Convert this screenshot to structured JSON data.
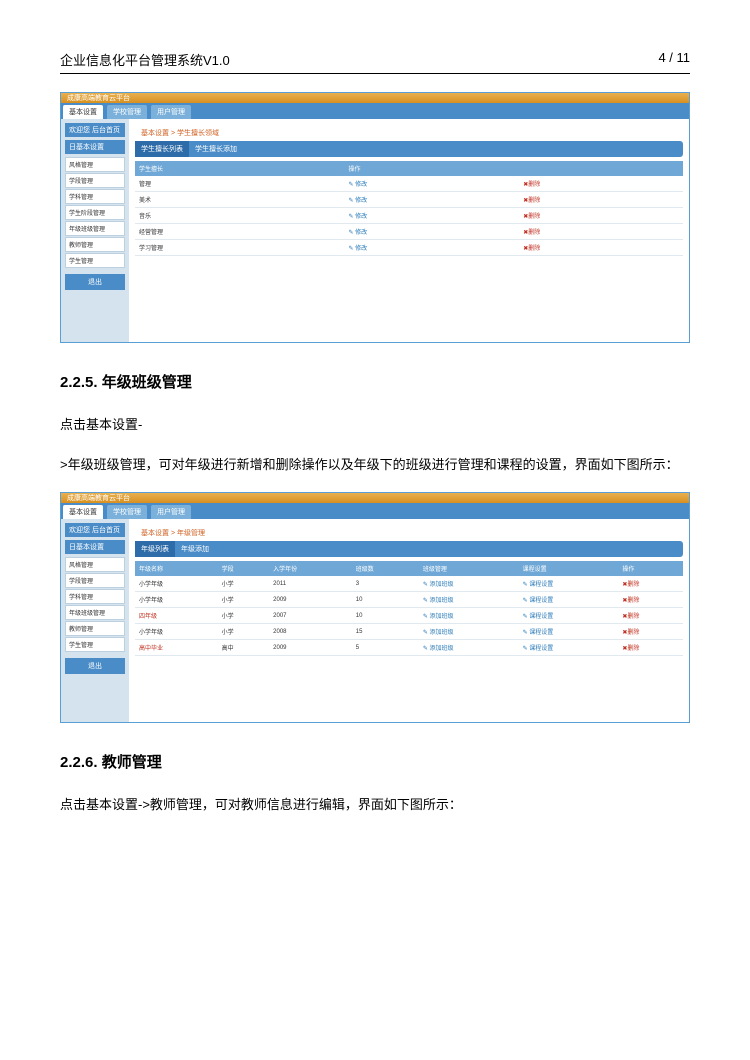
{
  "header": {
    "title": "企业信息化平台管理系统V1.0",
    "page": "4 / 11"
  },
  "s1": {
    "brand": "成康高端教育云平台",
    "tabs": [
      "基本设置",
      "学校管理",
      "用户管理"
    ],
    "crumb_prefix": "基本设置 >",
    "crumb_active": "学生擅长领域",
    "welcome": "欢迎您 后台首页",
    "side_title": "日基本设置",
    "side": [
      "风格管理",
      "学段管理",
      "学科管理",
      "学生阶段管理",
      "年级班级管理",
      "教师管理",
      "学生管理"
    ],
    "side_btn": "退出",
    "inner_tabs": [
      "学生擅长列表",
      "学生擅长添加"
    ],
    "cols": [
      "学生擅长",
      "操作",
      ""
    ],
    "rows": [
      [
        "管理",
        "✎ 修改",
        "✖删除"
      ],
      [
        "美术",
        "✎ 修改",
        "✖删除"
      ],
      [
        "音乐",
        "✎ 修改",
        "✖删除"
      ],
      [
        "经营管理",
        "✎ 修改",
        "✖删除"
      ],
      [
        "学习管理",
        "✎ 修改",
        "✖删除"
      ]
    ]
  },
  "sec1": {
    "h": "2.2.5. 年级班级管理",
    "p1": "点击基本设置-",
    "p2": ">年级班级管理，可对年级进行新增和删除操作以及年级下的班级进行管理和课程的设置，界面如下图所示："
  },
  "s2": {
    "brand": "成康高端教育云平台",
    "tabs": [
      "基本设置",
      "学校管理",
      "用户管理"
    ],
    "crumb_prefix": "基本设置 >",
    "crumb_active": "年级管理",
    "welcome": "欢迎您 后台首页",
    "side_title": "日基本设置",
    "side": [
      "风格管理",
      "学段管理",
      "学科管理",
      "年级班级管理",
      "教师管理",
      "学生管理"
    ],
    "side_btn": "退出",
    "inner_tabs": [
      "年级列表",
      "年级添加"
    ],
    "cols": [
      "年级名称",
      "学段",
      "入学年份",
      "班级数",
      "班级管理",
      "课程设置",
      "操作"
    ],
    "rows": [
      [
        "小学年级",
        "小学",
        "2011",
        "3",
        "✎ 添加班级",
        "✎ 课程设置",
        "✖删除"
      ],
      [
        "小学年级",
        "小学",
        "2009",
        "10",
        "✎ 添加班级",
        "✎ 课程设置",
        "✖删除"
      ],
      [
        "四年级",
        "小学",
        "2007",
        "10",
        "✎ 添加班级",
        "✎ 课程设置",
        "✖删除"
      ],
      [
        "小学年级",
        "小学",
        "2008",
        "15",
        "✎ 添加班级",
        "✎ 课程设置",
        "✖删除"
      ],
      [
        "高中毕业",
        "高中",
        "2009",
        "5",
        "✎ 添加班级",
        "✎ 课程设置",
        "✖删除"
      ]
    ]
  },
  "sec2": {
    "h": "2.2.6. 教师管理",
    "p1": "点击基本设置->教师管理，可对教师信息进行编辑，界面如下图所示："
  }
}
